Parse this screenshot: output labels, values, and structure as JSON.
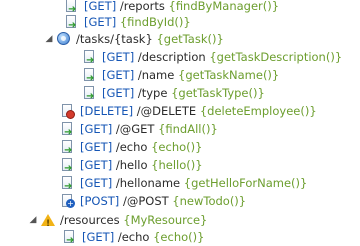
{
  "tree": {
    "rows": [
      {
        "indent": 4,
        "twisty": "",
        "icon": "doc-arrow",
        "verb": "[GET]",
        "path": "/reports",
        "method": "{findByManager()}"
      },
      {
        "indent": 4,
        "twisty": "",
        "icon": "doc-arrow",
        "verb": "[GET]",
        "path": "",
        "method": "{findById()}"
      },
      {
        "indent": 2,
        "twisty": "◢",
        "icon": "resource-circle",
        "verb": "",
        "path": "/tasks/{task}",
        "method": "{getTask()}"
      },
      {
        "indent": 4,
        "twisty": "",
        "icon": "doc-arrow",
        "verb": "[GET]",
        "path": "/description",
        "method": "{getTaskDescription()}"
      },
      {
        "indent": 4,
        "twisty": "",
        "icon": "doc-arrow",
        "verb": "[GET]",
        "path": "/name",
        "method": "{getTaskName()}"
      },
      {
        "indent": 4,
        "twisty": "",
        "icon": "doc-arrow",
        "verb": "[GET]",
        "path": "/type",
        "method": "{getTaskType()}"
      },
      {
        "indent": 2,
        "twisty": "",
        "icon": "doc-delete",
        "verb": "[DELETE]",
        "path": "/@DELETE",
        "method": "{deleteEmployee()}"
      },
      {
        "indent": 2,
        "twisty": "",
        "icon": "doc-arrow",
        "verb": "[GET]",
        "path": "/@GET",
        "method": "{findAll()}"
      },
      {
        "indent": 2,
        "twisty": "",
        "icon": "doc-arrow",
        "verb": "[GET]",
        "path": "/echo",
        "method": "{echo()}"
      },
      {
        "indent": 2,
        "twisty": "",
        "icon": "doc-arrow",
        "verb": "[GET]",
        "path": "/hello",
        "method": "{hello()}"
      },
      {
        "indent": 2,
        "twisty": "",
        "icon": "doc-arrow",
        "verb": "[GET]",
        "path": "/helloname",
        "method": "{getHelloForName()}"
      },
      {
        "indent": 2,
        "twisty": "",
        "icon": "doc-post",
        "verb": "[POST]",
        "path": "/@POST",
        "method": "{newTodo()}"
      },
      {
        "indent": 1,
        "twisty": "◢",
        "icon": "warning",
        "verb": "",
        "path": "/resources",
        "method": "{MyResource}"
      },
      {
        "indent": 3,
        "twisty": "",
        "icon": "doc-arrow",
        "verb": "[GET]",
        "path": "/echo",
        "method": "{echo()}"
      }
    ]
  }
}
